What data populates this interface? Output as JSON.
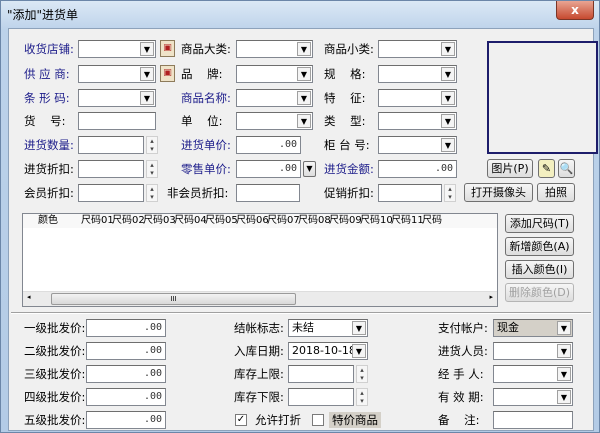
{
  "window": {
    "title": "\"添加\"进货单",
    "close_label": "x"
  },
  "top_fields": [
    {
      "label": "收货店铺:",
      "value": "",
      "highlight": true
    },
    {
      "label": "商品大类:",
      "value": "",
      "highlight": false
    },
    {
      "label": "商品小类:",
      "value": "",
      "highlight": false
    },
    {
      "label": "供 应 商:",
      "value": "",
      "highlight": true
    },
    {
      "label": "品    牌:",
      "value": "",
      "highlight": false
    },
    {
      "label": "规    格:",
      "value": "",
      "highlight": false
    },
    {
      "label": "条 形 码:",
      "value": "",
      "highlight": true
    },
    {
      "label": "商品名称:",
      "value": "",
      "highlight": true
    },
    {
      "label": "特    征:",
      "value": "",
      "highlight": false
    },
    {
      "label": "货    号:",
      "value": "",
      "highlight": false
    },
    {
      "label": "单    位:",
      "value": "",
      "highlight": false
    },
    {
      "label": "类    型:",
      "value": "",
      "highlight": false
    },
    {
      "label": "进货数量:",
      "value": "",
      "highlight": true
    },
    {
      "label": "进货单价:",
      "value": ".00",
      "highlight": true
    },
    {
      "label": "柜 台 号:",
      "value": "",
      "highlight": false
    },
    {
      "label": "进货折扣:",
      "value": "",
      "highlight": false
    },
    {
      "label": "零售单价:",
      "value": ".00",
      "highlight": true
    },
    {
      "label": "进货金额:",
      "value": ".00",
      "highlight": true
    },
    {
      "label": "会员折扣:",
      "value": "",
      "highlight": false
    },
    {
      "label": "非会员折扣:",
      "value": "",
      "highlight": false
    },
    {
      "label": "促销折扣:",
      "value": "",
      "highlight": false
    }
  ],
  "image_buttons": {
    "picture": "图片(P)",
    "open_camera": "打开摄像头",
    "photo": "拍照"
  },
  "grid": {
    "columns": [
      "颜色",
      "尺码01",
      "尺码02",
      "尺码03",
      "尺码04",
      "尺码05",
      "尺码06",
      "尺码07",
      "尺码08",
      "尺码09",
      "尺码10",
      "尺码11",
      "尺码"
    ],
    "scroll_thumb": "III"
  },
  "grid_buttons": [
    {
      "label": "添加尺码(T)",
      "enabled": true
    },
    {
      "label": "新增颜色(A)",
      "enabled": true
    },
    {
      "label": "插入颜色(I)",
      "enabled": true
    },
    {
      "label": "删除颜色(D)",
      "enabled": false
    }
  ],
  "bottom_fields": [
    {
      "label": "一级批发价:",
      "value": ".00"
    },
    {
      "label": "二级批发价:",
      "value": ".00"
    },
    {
      "label": "三级批发价:",
      "value": ".00"
    },
    {
      "label": "四级批发价:",
      "value": ".00"
    },
    {
      "label": "五级批发价:",
      "value": ".00"
    },
    {
      "label": "结帐标志:",
      "value": "未结"
    },
    {
      "label": "入库日期:",
      "value": "2018-10-18"
    },
    {
      "label": "库存上限:",
      "value": ""
    },
    {
      "label": "库存下限:",
      "value": ""
    },
    {
      "label": "支付帐户:",
      "value": "现金"
    },
    {
      "label": "进货人员:",
      "value": ""
    },
    {
      "label": "经 手 人:",
      "value": ""
    },
    {
      "label": "有 效 期:",
      "value": ""
    },
    {
      "label": "备    注:",
      "value": ""
    }
  ],
  "checkboxes": [
    {
      "label": "允许打折",
      "checked": true
    },
    {
      "label": "特价商品",
      "checked": false
    }
  ]
}
